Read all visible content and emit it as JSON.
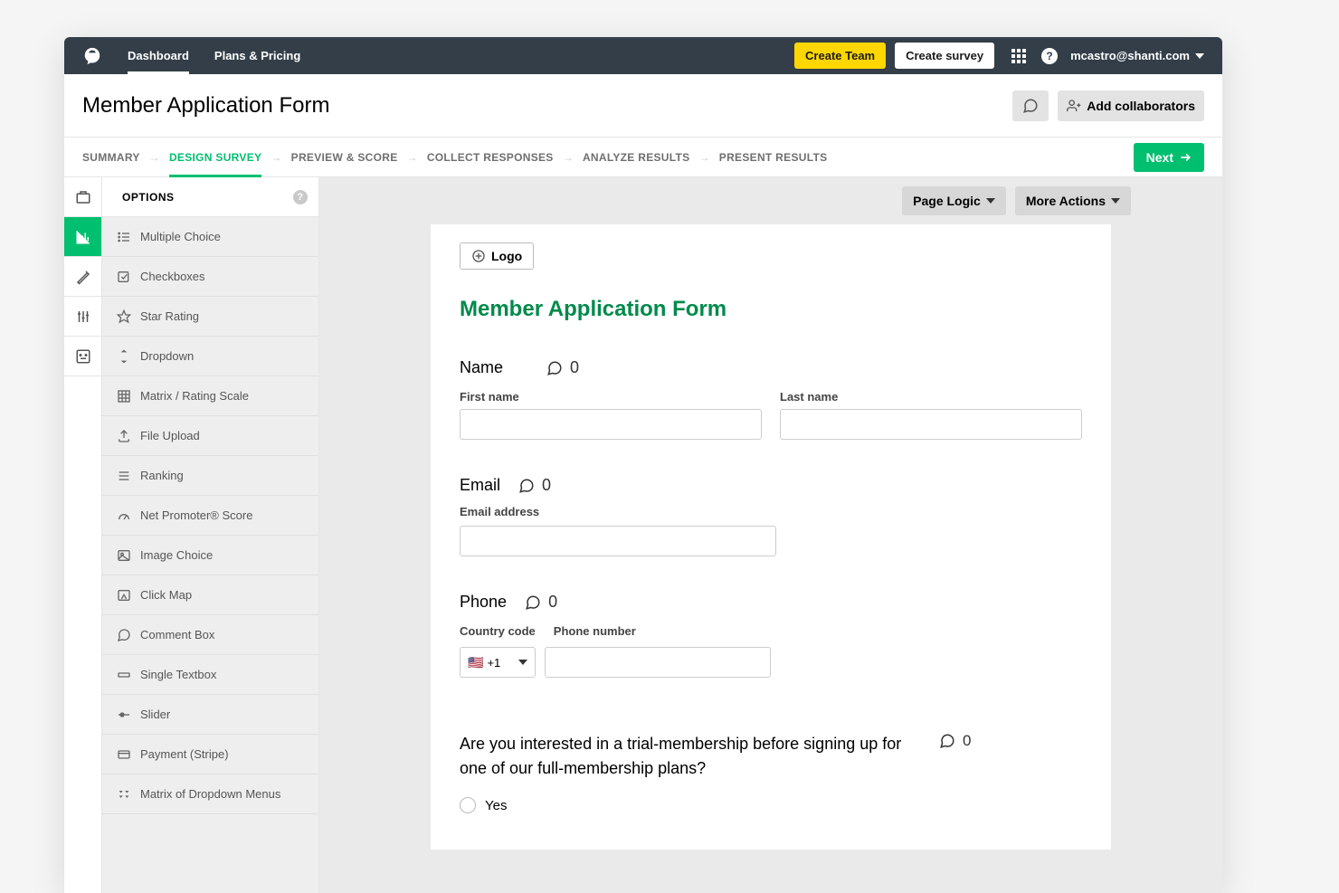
{
  "header": {
    "nav_dashboard": "Dashboard",
    "nav_plans": "Plans & Pricing",
    "create_team": "Create Team",
    "create_survey": "Create survey",
    "user_email": "mcastro@shanti.com"
  },
  "title_bar": {
    "title": "Member Application Form",
    "add_collaborators": "Add collaborators"
  },
  "steps": {
    "summary": "SUMMARY",
    "design": "DESIGN SURVEY",
    "preview": "PREVIEW & SCORE",
    "collect": "COLLECT RESPONSES",
    "analyze": "ANALYZE RESULTS",
    "present": "PRESENT RESULTS",
    "next": "Next"
  },
  "options_panel": {
    "header": "OPTIONS",
    "items": [
      "Multiple Choice",
      "Checkboxes",
      "Star Rating",
      "Dropdown",
      "Matrix / Rating Scale",
      "File Upload",
      "Ranking",
      "Net Promoter® Score",
      "Image Choice",
      "Click Map",
      "Comment Box",
      "Single Textbox",
      "Slider",
      "Payment (Stripe)",
      "Matrix of Dropdown Menus"
    ]
  },
  "canvas": {
    "page_logic": "Page Logic",
    "more_actions": "More Actions",
    "logo_btn": "Logo",
    "survey_title": "Member Application Form",
    "q_name": {
      "title": "Name",
      "comments": "0",
      "first_label": "First name",
      "last_label": "Last name"
    },
    "q_email": {
      "title": "Email",
      "comments": "0",
      "label": "Email address"
    },
    "q_phone": {
      "title": "Phone",
      "comments": "0",
      "cc_label": "Country code",
      "pn_label": "Phone number",
      "cc_value": "+1"
    },
    "q_trial": {
      "title": "Are you interested in a trial-membership before signing up for one of our full-membership plans?",
      "comments": "0",
      "opt_yes": "Yes"
    }
  }
}
